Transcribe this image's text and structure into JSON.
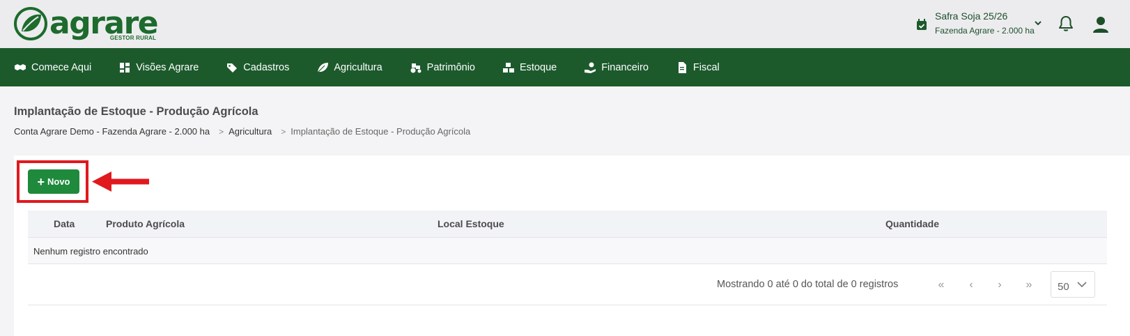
{
  "header": {
    "logo_word": "agrare",
    "logo_sub": "GESTOR RURAL",
    "safra_title": "Safra Soja 25/26",
    "safra_sub": "Fazenda Agrare - 2.000 ha"
  },
  "nav": {
    "items": [
      {
        "label": "Comece Aqui",
        "icon": "handshake-icon"
      },
      {
        "label": "Visões Agrare",
        "icon": "dashboard-icon"
      },
      {
        "label": "Cadastros",
        "icon": "tags-icon"
      },
      {
        "label": "Agricultura",
        "icon": "leaf-icon"
      },
      {
        "label": "Patrimônio",
        "icon": "tractor-icon"
      },
      {
        "label": "Estoque",
        "icon": "boxes-icon"
      },
      {
        "label": "Financeiro",
        "icon": "money-hand-icon"
      },
      {
        "label": "Fiscal",
        "icon": "invoice-icon"
      }
    ]
  },
  "page": {
    "title": "Implantação de Estoque - Produção Agrícola",
    "breadcrumb": [
      "Conta Agrare Demo - Fazenda Agrare - 2.000 ha",
      "Agricultura",
      "Implantação de Estoque - Produção Agrícola"
    ]
  },
  "toolbar": {
    "novo_label": "Novo"
  },
  "table": {
    "columns": [
      "Data",
      "Produto Agrícola",
      "Local Estoque",
      "Quantidade"
    ],
    "empty_message": "Nenhum registro encontrado"
  },
  "pagination": {
    "info": "Mostrando 0 até 0 do total de 0 registros",
    "first": "«",
    "prev": "‹",
    "next": "›",
    "last": "»",
    "per_page": "50"
  },
  "colors": {
    "brand_green": "#1c5a2c",
    "button_green": "#1f8a3c",
    "highlight_red": "#e0191e"
  }
}
